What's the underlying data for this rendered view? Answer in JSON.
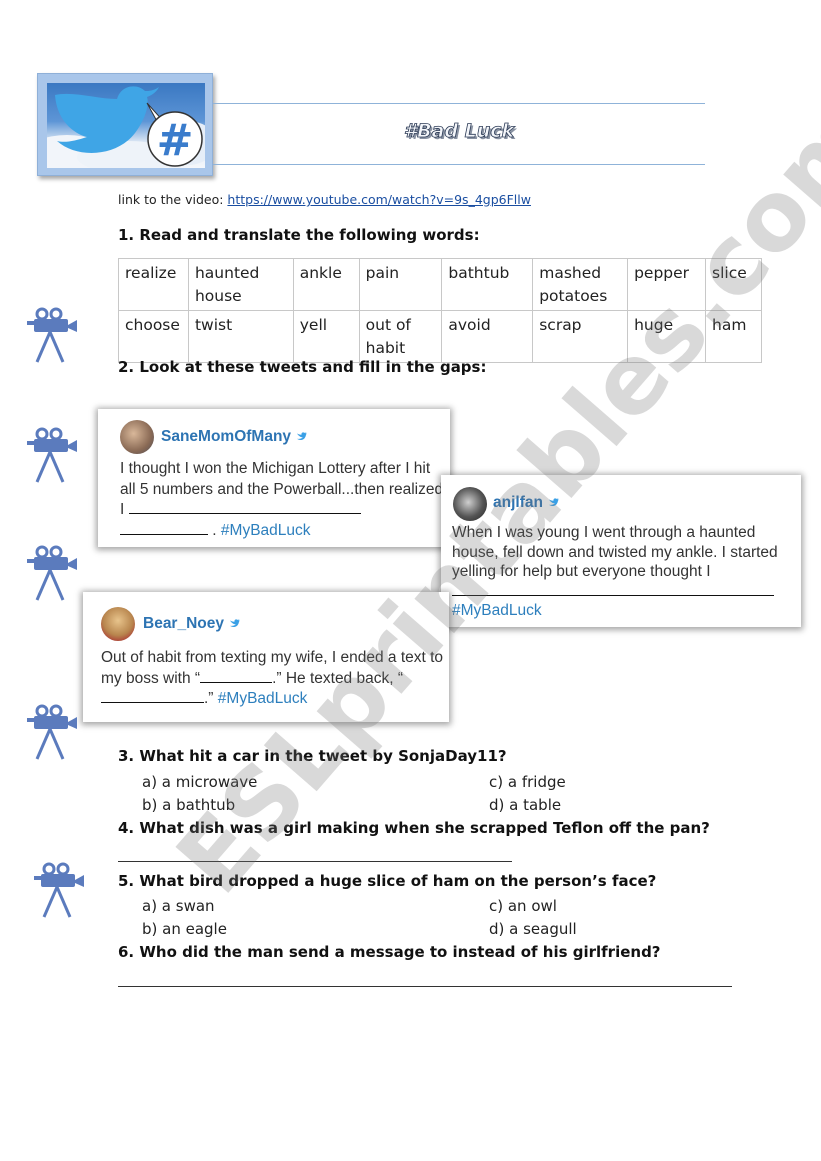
{
  "header": {
    "title": "#Bad Luck",
    "logo_icons": [
      "twitter-bird-icon",
      "hashtag-bubble-icon"
    ]
  },
  "video_link": {
    "label": "link to the video: ",
    "url_text": "https://www.youtube.com/watch?v=9s_4gp6Fllw"
  },
  "section1": {
    "heading": "1. Read and translate the following words:",
    "rows": [
      [
        "realize",
        "haunted house",
        "ankle",
        "pain",
        "bathtub",
        "mashed potatoes",
        "pepper",
        "slice"
      ],
      [
        "choose",
        "twist",
        "yell",
        "out of habit",
        "avoid",
        "scrap",
        "huge",
        "ham"
      ]
    ]
  },
  "section2": {
    "heading": "2. Look at these tweets and fill in the gaps:",
    "tweets": [
      {
        "user": "SaneMomOfMany",
        "text_a": "I thought I won the Michigan Lottery after I hit all 5 numbers and the Powerball...then realized I ",
        "text_b": " . ",
        "tag": "#MyBadLuck"
      },
      {
        "user": "anjlfan",
        "text_a": "When I was young I went through a haunted house, fell down and twisted my ankle. I started yelling for help but everyone thought I ",
        "tag": "#MyBadLuck"
      },
      {
        "user": "Bear_Noey",
        "text_a": "Out of habit from texting my wife, I ended a text to my boss with “",
        "text_b": ".” He texted back, “",
        "text_c": ".” ",
        "tag": "#MyBadLuck"
      }
    ]
  },
  "questions": {
    "q3": {
      "text": "3. What hit a car in the tweet by SonjaDay11?",
      "options": [
        "a)  a microwave",
        "b)  a bathtub",
        "c)  a fridge",
        "d)  a table"
      ]
    },
    "q4": {
      "text": "4. What dish was a girl making when she scrapped Teflon off the pan?"
    },
    "q5": {
      "text": "5.   What bird dropped a huge slice of ham on the person’s face?",
      "options": [
        "a)  a swan",
        "b)  an eagle",
        "c)  an owl",
        "d)  a seagull"
      ]
    },
    "q6": {
      "text": "6.   Who did the man send a message to instead of his girlfriend?"
    }
  },
  "side_icons": [
    "movie-camera-icon",
    "movie-camera-icon",
    "movie-camera-icon",
    "movie-camera-icon",
    "movie-camera-icon"
  ],
  "watermark": "ESLprintables.com",
  "colors": {
    "accent_blue": "#2d74b3",
    "icon_blue": "#5b7bbd",
    "link_blue": "#1a4ea1"
  }
}
